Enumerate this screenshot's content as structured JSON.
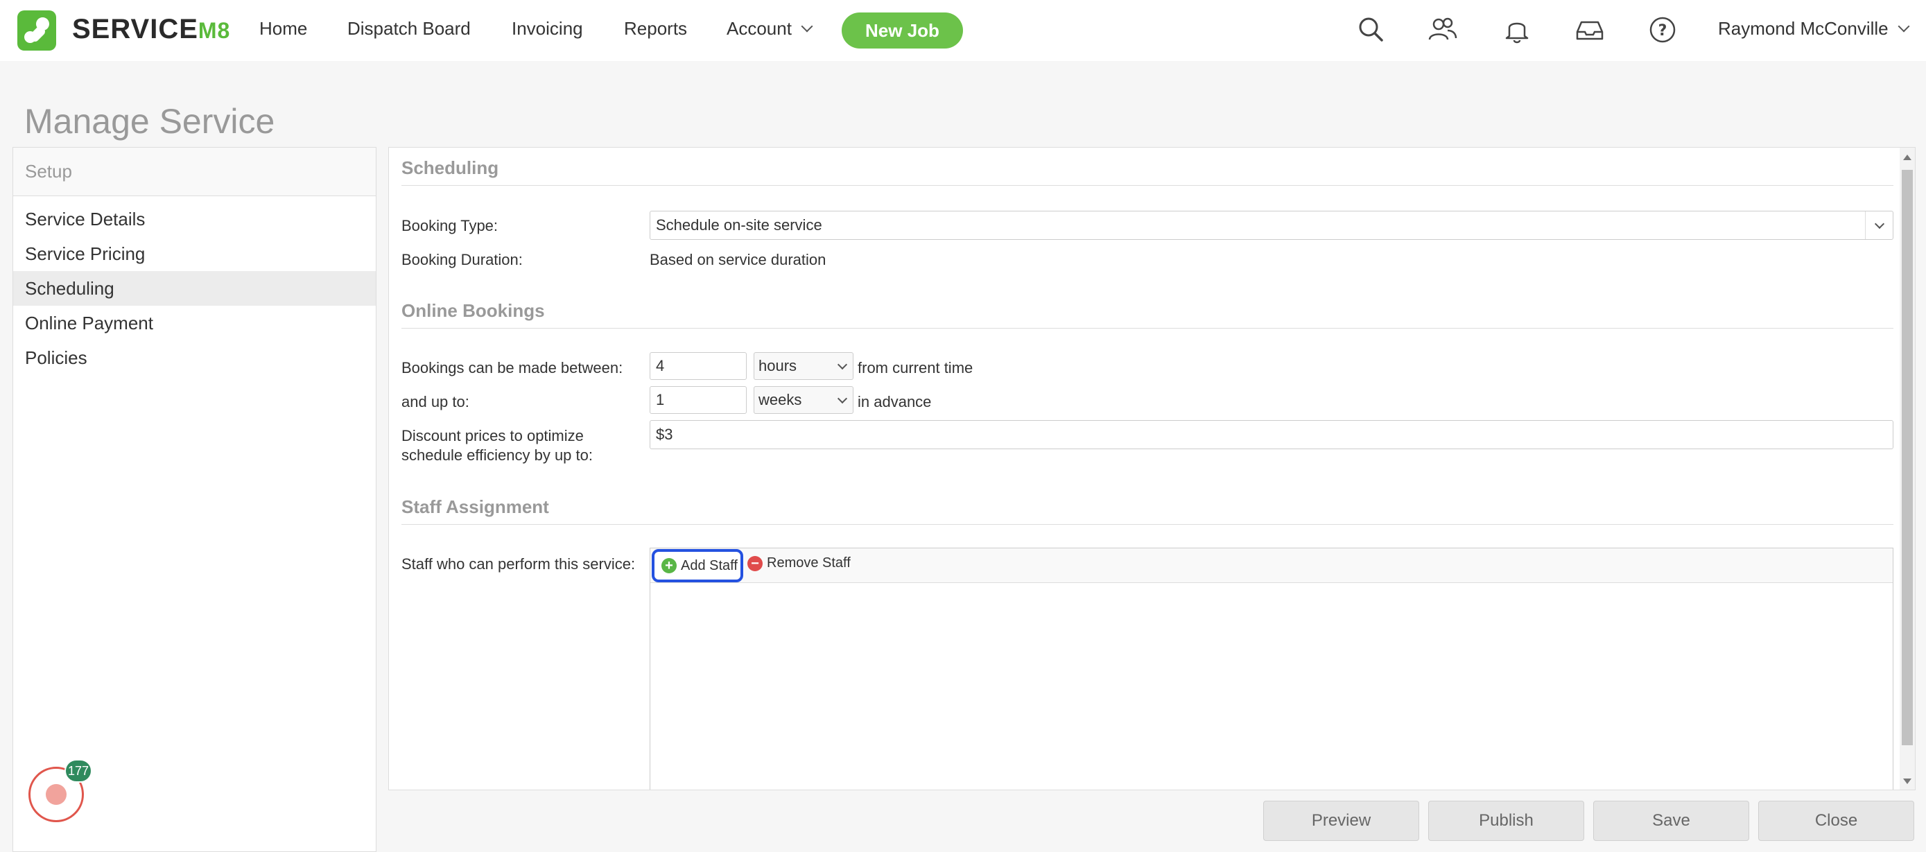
{
  "brand": {
    "name": "SERVICE",
    "suffix": "M8"
  },
  "nav": {
    "home": "Home",
    "dispatch": "Dispatch Board",
    "invoicing": "Invoicing",
    "reports": "Reports",
    "account": "Account",
    "new_job": "New Job",
    "user": "Raymond McConville"
  },
  "icons": [
    "search-icon",
    "people-icon",
    "bell-icon",
    "inbox-icon",
    "help-icon"
  ],
  "page_title": "Manage Service",
  "sidebar": {
    "header": "Setup",
    "items": [
      {
        "label": "Service Details"
      },
      {
        "label": "Service Pricing"
      },
      {
        "label": "Scheduling"
      },
      {
        "label": "Online Payment"
      },
      {
        "label": "Policies"
      }
    ],
    "active": "Scheduling",
    "notification_count": "177"
  },
  "scheduling": {
    "title": "Scheduling",
    "booking_type_label": "Booking Type:",
    "booking_type_value": "Schedule on-site service",
    "booking_duration_label": "Booking Duration:",
    "booking_duration_value": "Based on service duration"
  },
  "online_bookings": {
    "title": "Online Bookings",
    "between_label": "Bookings can be made between:",
    "between_value": "4",
    "between_unit": "hours",
    "between_suffix": "from current time",
    "upto_label": "and up to:",
    "upto_value": "1",
    "upto_unit": "weeks",
    "upto_suffix": "in advance",
    "discount_label_1": "Discount prices to optimize",
    "discount_label_2": "schedule efficiency by up to:",
    "discount_value": "$3"
  },
  "staff": {
    "title": "Staff Assignment",
    "label": "Staff who can perform this service:",
    "add": "Add Staff",
    "remove": "Remove Staff"
  },
  "footer": {
    "preview": "Preview",
    "publish": "Publish",
    "save": "Save",
    "close": "Close"
  },
  "colors": {
    "accent": "#6cc24a",
    "focus": "#2451e0"
  }
}
